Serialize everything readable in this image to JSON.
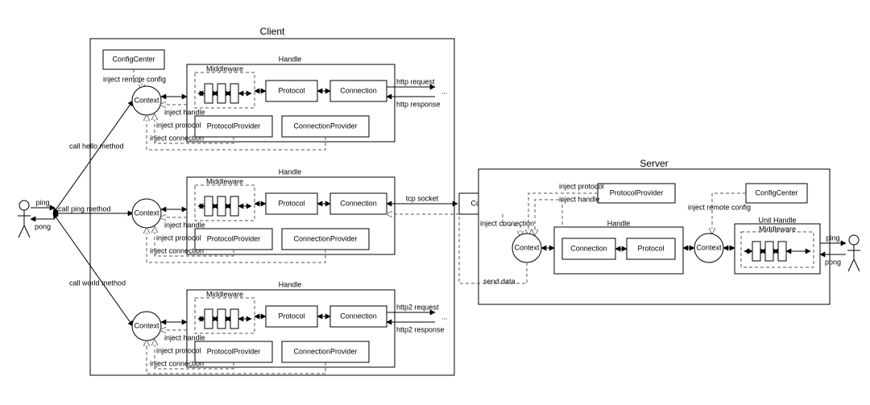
{
  "client": {
    "title": "Client",
    "config_center": "ConfigCenter",
    "inject_remote_config": "inject remote config",
    "actor_ping": "ping",
    "actor_pong": "pong",
    "call_hello": "call hello method",
    "call_ping": "call ping method",
    "call_world": "call world method",
    "handles": [
      {
        "handle_title": "Handle",
        "context": "Context",
        "middleware": "Middleware",
        "protocol": "Protocol",
        "connection": "Connection",
        "protocol_provider": "ProtocolProvider",
        "connection_provider": "ConnectionProvider",
        "inject_handle": "inject handle",
        "inject_protocol": "inject protocol",
        "inject_connection": "inject connection",
        "out_top": "http request",
        "out_bot": "http response",
        "out_dots": "..."
      },
      {
        "handle_title": "Handle",
        "context": "Context",
        "middleware": "Middleware",
        "protocol": "Protocol",
        "connection": "Connection",
        "protocol_provider": "ProtocolProvider",
        "connection_provider": "ConnectionProvider",
        "inject_handle": "inject handle",
        "inject_protocol": "inject protocol",
        "inject_connection": "inject connection",
        "out_top": "tcp socket",
        "out_bot": "",
        "out_dots": ""
      },
      {
        "handle_title": "Handle",
        "context": "Context",
        "middleware": "Middleware",
        "protocol": "Protocol",
        "connection": "Connection",
        "protocol_provider": "ProtocolProvider",
        "connection_provider": "ConnectionProvider",
        "inject_handle": "inject handle",
        "inject_protocol": "inject protocol",
        "inject_connection": "inject connection",
        "out_top": "http2 request",
        "out_bot": "http2 response",
        "out_dots": "..."
      }
    ]
  },
  "server": {
    "title": "Server",
    "config_center": "ConfigCenter",
    "inject_remote_config": "inject remote config",
    "connection_provider": "ConnectionProvider",
    "protocol_provider": "ProtocolProvider",
    "inject_protocol": "inject protocol",
    "inject_handle": "inject handle",
    "inject_connection": "inject connection",
    "send_data": "send data",
    "handle": {
      "title": "Handle",
      "connection": "Connection",
      "protocol": "Protocol"
    },
    "context_left": "Context",
    "context_right": "Context",
    "unit_handle": {
      "title": "Unit Handle",
      "middleware": "Middleware"
    },
    "actor_ping": "ping",
    "actor_pong": "pong"
  }
}
